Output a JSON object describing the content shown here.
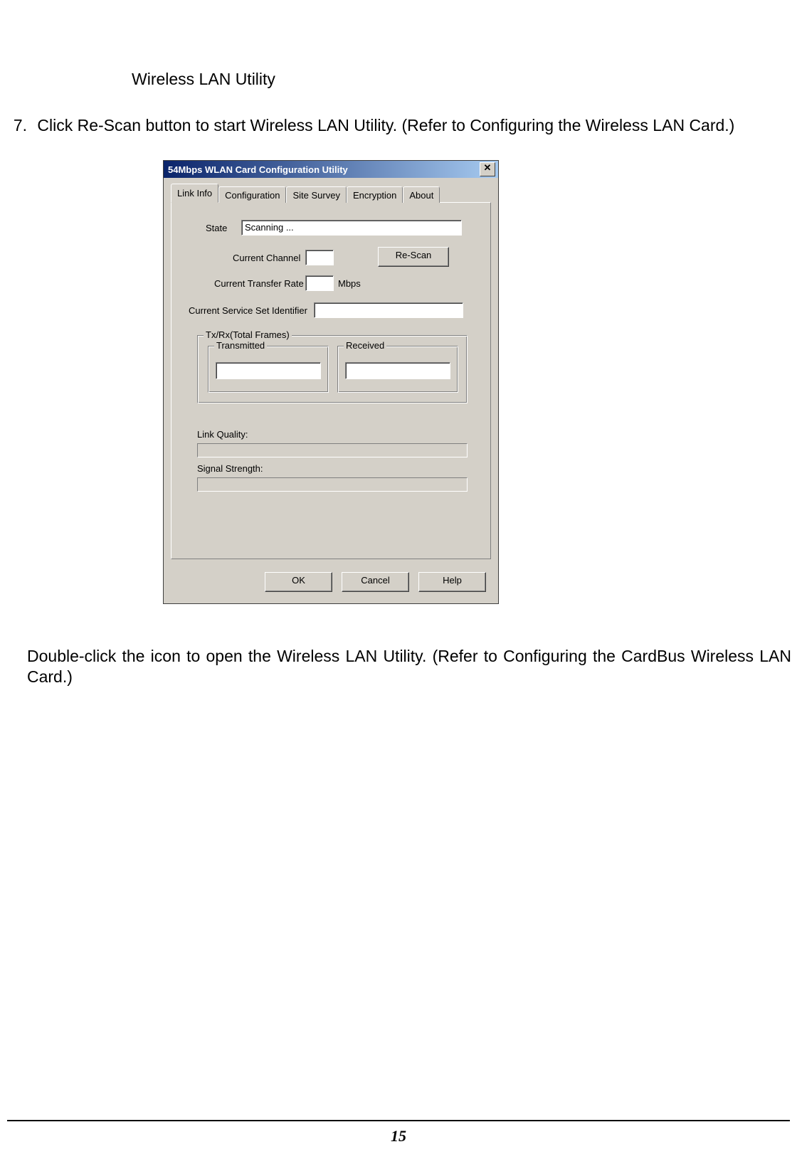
{
  "doc": {
    "heading": "Wireless LAN Utility",
    "step_number": "7.",
    "step_text": "Click Re-Scan button to start Wireless LAN Utility. (Refer to Configuring the Wireless LAN Card.)",
    "paragraph2": "Double-click the icon to open the Wireless LAN Utility. (Refer to Configuring the CardBus Wireless LAN Card.)",
    "page_number": "15"
  },
  "dialog": {
    "title": "54Mbps WLAN Card Configuration Utility",
    "close_glyph": "✕",
    "tabs": [
      "Link Info",
      "Configuration",
      "Site Survey",
      "Encryption",
      "About"
    ],
    "labels": {
      "state": "State",
      "current_channel": "Current Channel",
      "current_transfer_rate": "Current Transfer Rate",
      "mbps": "Mbps",
      "current_ssid": "Current Service Set Identifier",
      "txrx_group": "Tx/Rx(Total Frames)",
      "transmitted": "Transmitted",
      "received": "Received",
      "link_quality": "Link Quality:",
      "signal_strength": "Signal Strength:"
    },
    "values": {
      "state": "Scanning ...",
      "current_channel": "",
      "transfer_rate": "",
      "ssid": "",
      "transmitted": "",
      "received": ""
    },
    "buttons": {
      "rescan": "Re-Scan",
      "ok": "OK",
      "cancel": "Cancel",
      "help": "Help"
    }
  }
}
